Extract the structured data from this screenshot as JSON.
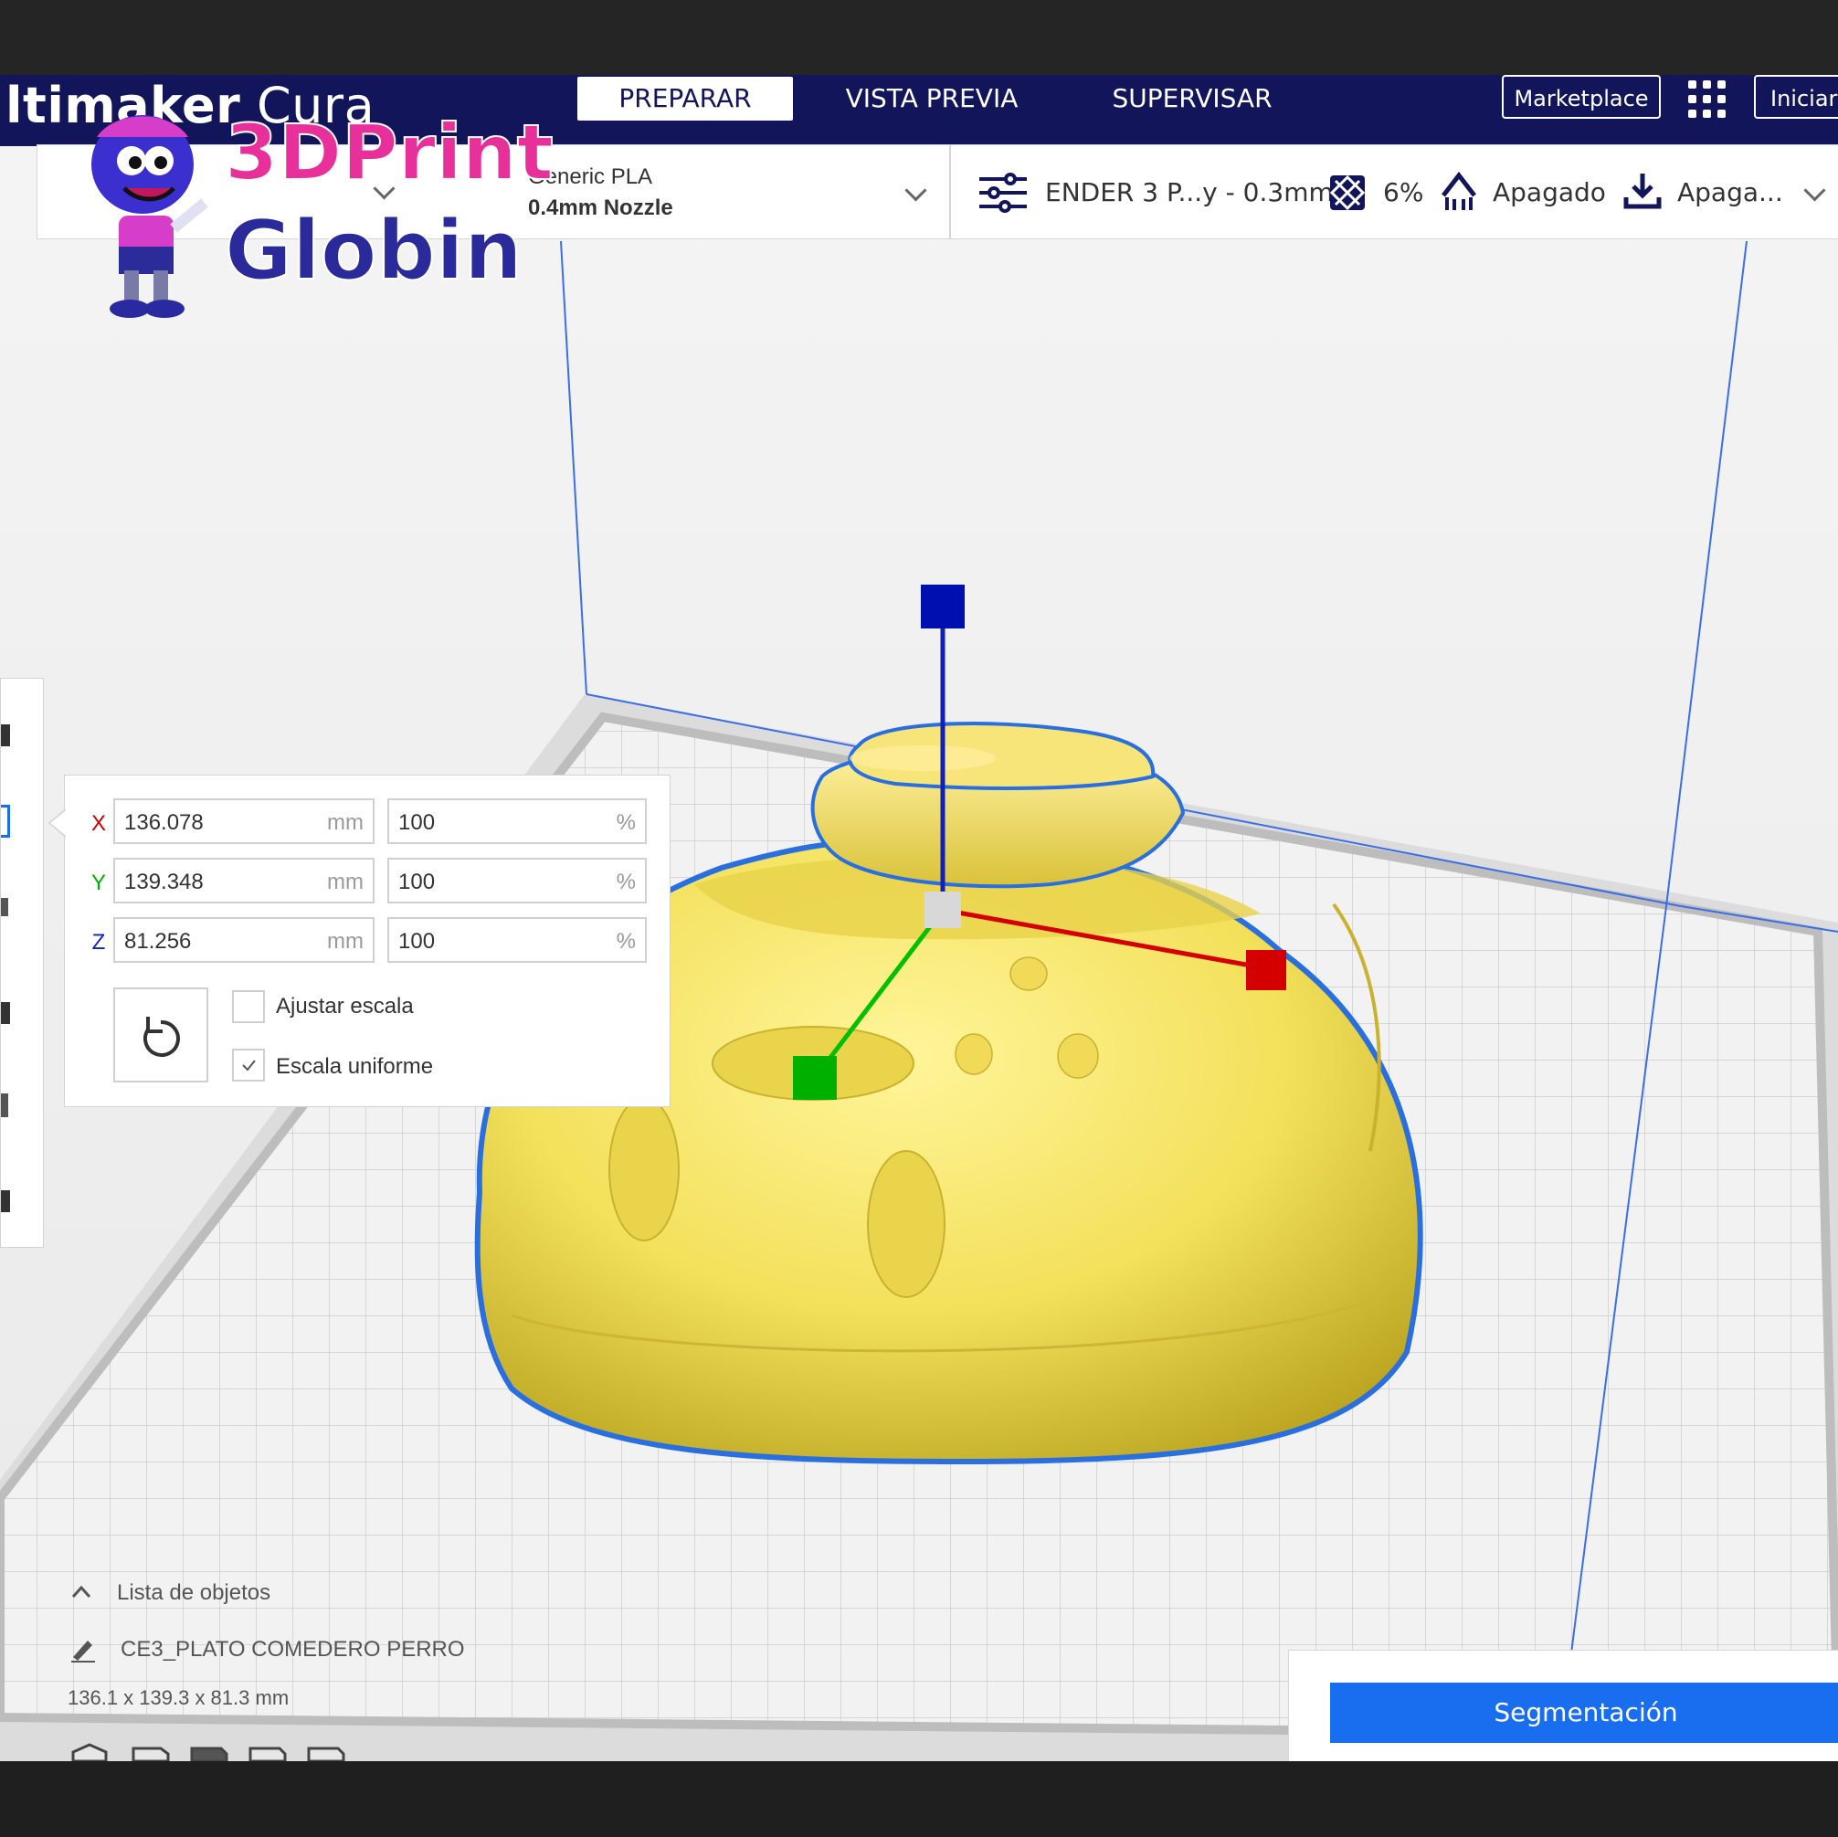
{
  "app": {
    "title_prefix": "ltimaker",
    "title_suffix": "Cura"
  },
  "header": {
    "tabs": [
      {
        "label": "PREPARAR",
        "active": true
      },
      {
        "label": "VISTA PREVIA",
        "active": false
      },
      {
        "label": "SUPERVISAR",
        "active": false
      }
    ],
    "marketplace_label": "Marketplace",
    "signin_label": "Iniciar"
  },
  "logo": {
    "line1": "3DPrint",
    "line2": "Globin"
  },
  "printer_bar": {
    "material": "Generic PLA",
    "nozzle": "0.4mm Nozzle"
  },
  "print_settings": {
    "profile": "ENDER 3 P...y - 0.3mm",
    "infill": "6%",
    "support": "Apagado",
    "adhesion": "Apaga..."
  },
  "scale_panel": {
    "rows": [
      {
        "axis": "X",
        "mm": "136.078",
        "unit_mm": "mm",
        "pct": "100",
        "unit_pct": "%"
      },
      {
        "axis": "Y",
        "mm": "139.348",
        "unit_mm": "mm",
        "pct": "100",
        "unit_pct": "%"
      },
      {
        "axis": "Z",
        "mm": "81.256",
        "unit_mm": "mm",
        "pct": "100",
        "unit_pct": "%"
      }
    ],
    "snap_label": "Ajustar escala",
    "snap_checked": false,
    "uniform_label": "Escala uniforme",
    "uniform_checked": true
  },
  "object_list": {
    "label": "Lista de objetos",
    "object_name": "CE3_PLATO COMEDERO PERRO",
    "dimensions": "136.1 x 139.3 x 81.3 mm"
  },
  "slice_button": "Segmentación",
  "colors": {
    "header": "#13155a",
    "accent": "#196ef0",
    "model": "#f3e262",
    "axis_x": "#d40000",
    "axis_y": "#00b000",
    "axis_z": "#0010b0"
  }
}
